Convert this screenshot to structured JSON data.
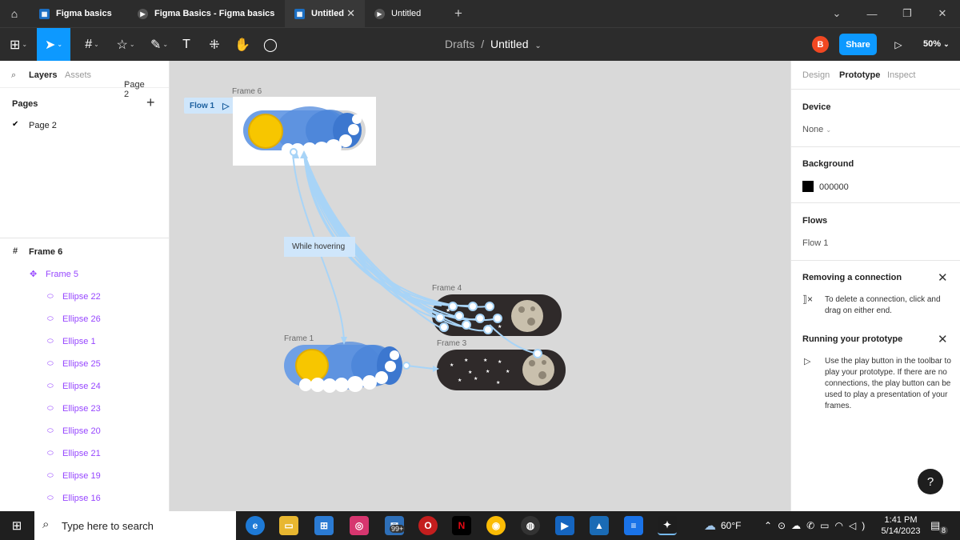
{
  "browser": {
    "tabs": [
      {
        "label": "Figma basics",
        "icon": "figma-file-icon"
      },
      {
        "label": "Figma Basics - Figma basics",
        "icon": "play-icon"
      },
      {
        "label": "Untitled",
        "icon": "figma-file-icon"
      },
      {
        "label": "Untitled",
        "icon": "play-icon"
      }
    ]
  },
  "toolbar": {
    "breadcrumb_folder": "Drafts",
    "breadcrumb_sep": "/",
    "file_name": "Untitled",
    "avatar_initial": "B",
    "share_label": "Share",
    "zoom": "50%"
  },
  "left_panel": {
    "tabs": [
      "Layers",
      "Assets"
    ],
    "page_selector": "Page 2",
    "pages_heading": "Pages",
    "pages": [
      "Page 2"
    ],
    "layers": [
      {
        "label": "Frame 6",
        "icon": "frame-icon"
      },
      {
        "label": "Frame 5",
        "icon": "component-icon"
      },
      {
        "label": "Ellipse 22",
        "icon": "ellipse-icon"
      },
      {
        "label": "Ellipse 26",
        "icon": "ellipse-icon"
      },
      {
        "label": "Ellipse 1",
        "icon": "ellipse-icon"
      },
      {
        "label": "Ellipse 25",
        "icon": "ellipse-icon"
      },
      {
        "label": "Ellipse 24",
        "icon": "ellipse-icon"
      },
      {
        "label": "Ellipse 23",
        "icon": "ellipse-icon"
      },
      {
        "label": "Ellipse 20",
        "icon": "ellipse-icon"
      },
      {
        "label": "Ellipse 21",
        "icon": "ellipse-icon"
      },
      {
        "label": "Ellipse 19",
        "icon": "ellipse-icon"
      },
      {
        "label": "Ellipse 16",
        "icon": "ellipse-icon"
      }
    ]
  },
  "canvas": {
    "flow_badge": "Flow 1",
    "frames": [
      "Frame 6",
      "Frame 4",
      "Frame 1",
      "Frame 3"
    ],
    "interaction_tooltip": "While hovering"
  },
  "right_panel": {
    "tabs": [
      "Design",
      "Prototype",
      "Inspect"
    ],
    "active_tab": "Prototype",
    "device_heading": "Device",
    "device_value": "None",
    "background_heading": "Background",
    "background_hex": "000000",
    "flows_heading": "Flows",
    "flow_item": "Flow 1",
    "removing_heading": "Removing a connection",
    "removing_text": "To delete a connection, click and drag on either end.",
    "running_heading": "Running your prototype",
    "running_text": "Use the play button in the toolbar to play your prototype. If there are no connections, the play button can be used to play a presentation of your frames.",
    "help_label": "?"
  },
  "taskbar": {
    "search_placeholder": "Type here to search",
    "mail_badge": "99+",
    "weather": "60°F",
    "time": "1:41 PM",
    "date": "5/14/2023",
    "notification_count": "8"
  },
  "colors": {
    "accent": "#0d99ff",
    "sky": "#4f86d6",
    "night": "#2f2a2a",
    "sun": "#f7c600",
    "moon": "#c9c0ad"
  }
}
